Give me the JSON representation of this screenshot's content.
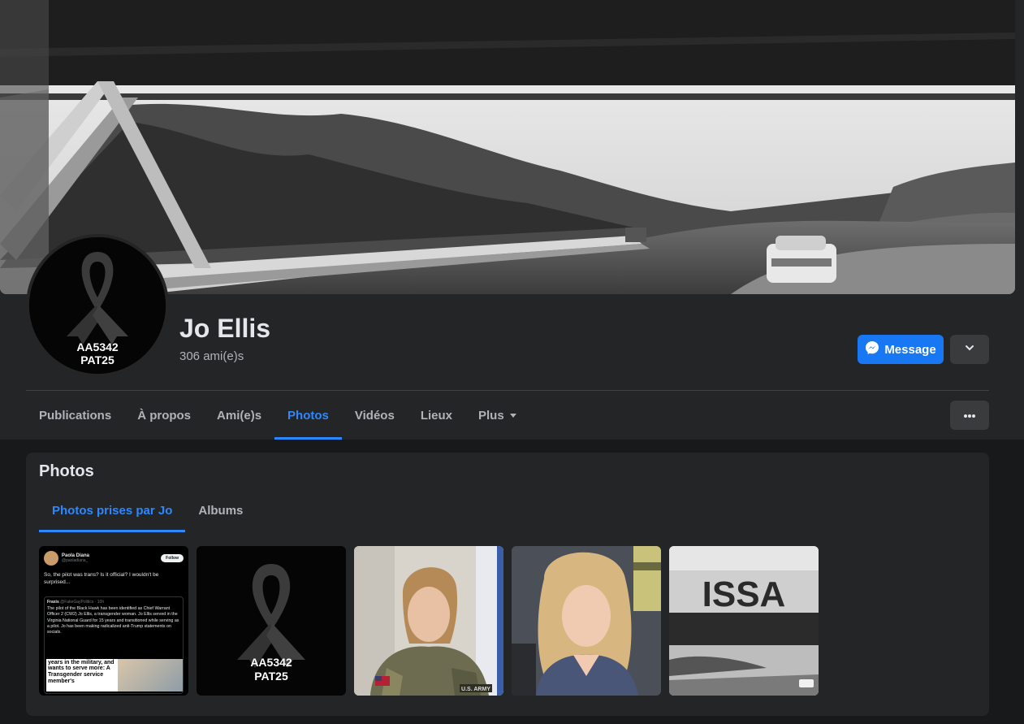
{
  "profile": {
    "name": "Jo Ellis",
    "friends": "306 ami(e)s",
    "avatar_text": [
      "AA5342",
      "PAT25"
    ]
  },
  "actions": {
    "message": "Message"
  },
  "nav": {
    "tabs": [
      "Publications",
      "À propos",
      "Ami(e)s",
      "Photos",
      "Vidéos",
      "Lieux",
      "Plus"
    ],
    "active": "Photos"
  },
  "photos": {
    "title": "Photos",
    "subtabs": [
      "Photos prises par Jo",
      "Albums"
    ],
    "active_subtab": "Photos prises par Jo",
    "tweet": {
      "author": "Paola Diana",
      "handle": "@paoladiana_",
      "follow": "Follow",
      "text": "So, the pilot was trans? Is it official? I wouldn't be surprised...",
      "quote_author": "Fraxis",
      "quote_meta": "@FakeGayPolitics · 10h",
      "quote_text": "The pilot of the Black Hawk has been identified as Chief Warrant Officer 2 (CW2) Jo Ellis, a transgender woman. Jo Ellis served in the Virginia National Guard for 15 years and transitioned while serving as a pilot. Jo has been making radicalized anti-Trump statements on socials.",
      "inset_text": "years in the military, and wants to serve more: A Transgender service member's"
    },
    "thumb_text": {
      "ribbon": [
        "AA5342",
        "PAT25"
      ],
      "sign": "ISSA",
      "patch": "U.S. ARMY"
    }
  },
  "colors": {
    "accent": "#2d88ff",
    "message_button": "#1877f2",
    "surface": "#242526",
    "background": "#18191a"
  },
  "icons": {
    "message": "messenger-icon",
    "dropdown": "chevron-down-icon",
    "plus_caret": "caret-down-icon",
    "more": "ellipsis-icon"
  }
}
